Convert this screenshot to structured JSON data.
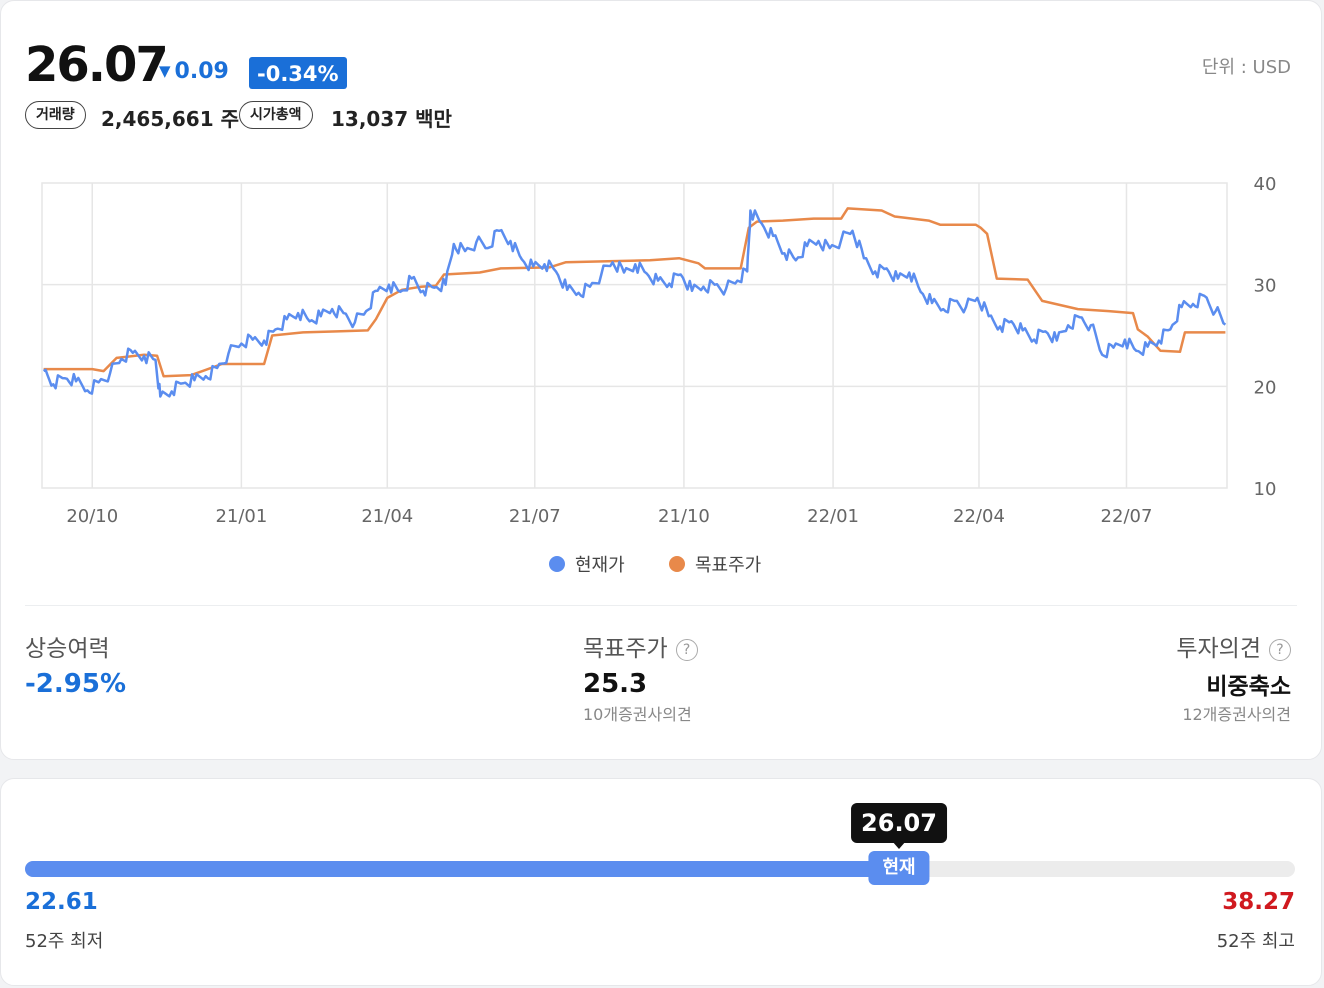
{
  "quote": {
    "price": "26.07",
    "change": "0.09",
    "change_arrow": "▼",
    "change_pct": "-0.34%",
    "unit": "단위 : USD",
    "volume_label": "거래량",
    "volume_value": "2,465,661 주",
    "market_cap_label": "시가총액",
    "market_cap_value": "13,037 백만"
  },
  "colors": {
    "current": "#5b8def",
    "target": "#e8894a",
    "down": "#1a6fd8",
    "high": "#d0191f"
  },
  "chart_data": {
    "type": "line",
    "x_ticks": [
      "20/10",
      "21/01",
      "21/04",
      "21/07",
      "21/10",
      "22/01",
      "22/04",
      "22/07"
    ],
    "x_tick_dates": [
      "2020-10-01",
      "2021-01-01",
      "2021-04-01",
      "2021-07-01",
      "2021-10-01",
      "2022-01-01",
      "2022-04-01",
      "2022-07-01"
    ],
    "x_range": [
      "2020-08-31",
      "2022-09-01"
    ],
    "y_ticks": [
      10,
      20,
      30,
      40
    ],
    "ylim": [
      10,
      40
    ],
    "grid": true,
    "y_axis_side": "right",
    "legend_position": "bottom-center",
    "series": [
      {
        "name": "현재가",
        "color": "#5b8def",
        "points": [
          [
            "2020-09-01",
            21.5
          ],
          [
            "2020-09-07",
            20.2
          ],
          [
            "2020-09-14",
            20.8
          ],
          [
            "2020-09-21",
            20.5
          ],
          [
            "2020-09-28",
            19.6
          ],
          [
            "2020-10-05",
            20.4
          ],
          [
            "2020-10-12",
            21.3
          ],
          [
            "2020-10-19",
            22.7
          ],
          [
            "2020-10-26",
            23.3
          ],
          [
            "2020-11-02",
            23.0
          ],
          [
            "2020-11-09",
            22.6
          ],
          [
            "2020-11-12",
            19.0
          ],
          [
            "2020-11-19",
            19.5
          ],
          [
            "2020-11-26",
            20.3
          ],
          [
            "2020-12-03",
            20.6
          ],
          [
            "2020-12-10",
            21.0
          ],
          [
            "2020-12-17",
            21.8
          ],
          [
            "2020-12-24",
            23.2
          ],
          [
            "2021-01-01",
            24.2
          ],
          [
            "2021-01-08",
            24.6
          ],
          [
            "2021-01-15",
            24.5
          ],
          [
            "2021-01-22",
            25.6
          ],
          [
            "2021-01-29",
            26.6
          ],
          [
            "2021-02-05",
            27.2
          ],
          [
            "2021-02-12",
            26.4
          ],
          [
            "2021-02-19",
            26.9
          ],
          [
            "2021-02-26",
            27.6
          ],
          [
            "2021-03-05",
            27.2
          ],
          [
            "2021-03-12",
            26.3
          ],
          [
            "2021-03-19",
            27.4
          ],
          [
            "2021-03-26",
            29.4
          ],
          [
            "2021-04-02",
            30.0
          ],
          [
            "2021-04-09",
            29.3
          ],
          [
            "2021-04-16",
            30.6
          ],
          [
            "2021-04-23",
            29.4
          ],
          [
            "2021-04-30",
            29.7
          ],
          [
            "2021-05-07",
            30.0
          ],
          [
            "2021-05-12",
            34.0
          ],
          [
            "2021-05-19",
            33.3
          ],
          [
            "2021-05-26",
            34.2
          ],
          [
            "2021-06-02",
            33.6
          ],
          [
            "2021-06-09",
            35.3
          ],
          [
            "2021-06-16",
            34.3
          ],
          [
            "2021-06-23",
            32.5
          ],
          [
            "2021-06-30",
            31.8
          ],
          [
            "2021-07-07",
            32.0
          ],
          [
            "2021-07-14",
            31.3
          ],
          [
            "2021-07-21",
            29.5
          ],
          [
            "2021-07-28",
            29.2
          ],
          [
            "2021-08-04",
            29.8
          ],
          [
            "2021-08-11",
            31.0
          ],
          [
            "2021-08-18",
            32.2
          ],
          [
            "2021-08-25",
            31.2
          ],
          [
            "2021-09-01",
            32.0
          ],
          [
            "2021-09-08",
            31.1
          ],
          [
            "2021-09-15",
            30.4
          ],
          [
            "2021-09-22",
            30.1
          ],
          [
            "2021-09-29",
            31.0
          ],
          [
            "2021-10-06",
            29.4
          ],
          [
            "2021-10-13",
            29.8
          ],
          [
            "2021-10-20",
            30.0
          ],
          [
            "2021-10-27",
            29.6
          ],
          [
            "2021-11-03",
            30.4
          ],
          [
            "2021-11-09",
            31.3
          ],
          [
            "2021-11-11",
            37.3
          ],
          [
            "2021-11-18",
            36.0
          ],
          [
            "2021-11-25",
            34.8
          ],
          [
            "2021-12-02",
            33.1
          ],
          [
            "2021-12-09",
            32.4
          ],
          [
            "2021-12-16",
            33.8
          ],
          [
            "2021-12-23",
            34.3
          ],
          [
            "2021-12-30",
            33.6
          ],
          [
            "2022-01-06",
            34.4
          ],
          [
            "2022-01-13",
            35.3
          ],
          [
            "2022-01-20",
            32.6
          ],
          [
            "2022-01-27",
            31.3
          ],
          [
            "2022-02-03",
            31.6
          ],
          [
            "2022-02-10",
            30.6
          ],
          [
            "2022-02-17",
            31.2
          ],
          [
            "2022-02-24",
            29.3
          ],
          [
            "2022-03-03",
            28.2
          ],
          [
            "2022-03-10",
            27.6
          ],
          [
            "2022-03-17",
            28.4
          ],
          [
            "2022-03-24",
            27.8
          ],
          [
            "2022-03-31",
            28.7
          ],
          [
            "2022-04-07",
            26.9
          ],
          [
            "2022-04-14",
            25.9
          ],
          [
            "2022-04-21",
            26.4
          ],
          [
            "2022-04-28",
            25.5
          ],
          [
            "2022-05-05",
            24.6
          ],
          [
            "2022-05-12",
            25.4
          ],
          [
            "2022-05-19",
            24.5
          ],
          [
            "2022-05-26",
            26.0
          ],
          [
            "2022-06-02",
            26.8
          ],
          [
            "2022-06-09",
            26.0
          ],
          [
            "2022-06-16",
            23.1
          ],
          [
            "2022-06-23",
            23.8
          ],
          [
            "2022-06-30",
            24.6
          ],
          [
            "2022-07-07",
            23.5
          ],
          [
            "2022-07-14",
            23.9
          ],
          [
            "2022-07-21",
            24.5
          ],
          [
            "2022-07-28",
            25.6
          ],
          [
            "2022-08-04",
            27.8
          ],
          [
            "2022-08-11",
            28.1
          ],
          [
            "2022-08-18",
            28.9
          ],
          [
            "2022-08-25",
            27.4
          ],
          [
            "2022-08-31",
            26.07
          ]
        ]
      },
      {
        "name": "목표주가",
        "color": "#e8894a",
        "points": [
          [
            "2020-09-01",
            21.7
          ],
          [
            "2020-10-01",
            21.7
          ],
          [
            "2020-10-08",
            21.5
          ],
          [
            "2020-10-16",
            22.8
          ],
          [
            "2020-11-02",
            23.1
          ],
          [
            "2020-11-10",
            23.0
          ],
          [
            "2020-11-14",
            21.0
          ],
          [
            "2020-12-01",
            21.1
          ],
          [
            "2020-12-08",
            21.5
          ],
          [
            "2020-12-20",
            22.2
          ],
          [
            "2021-01-15",
            22.2
          ],
          [
            "2021-01-20",
            25.0
          ],
          [
            "2021-02-08",
            25.3
          ],
          [
            "2021-03-01",
            25.4
          ],
          [
            "2021-03-20",
            25.5
          ],
          [
            "2021-03-25",
            26.6
          ],
          [
            "2021-04-01",
            28.7
          ],
          [
            "2021-04-10",
            29.5
          ],
          [
            "2021-04-22",
            29.8
          ],
          [
            "2021-05-01",
            29.9
          ],
          [
            "2021-05-06",
            31.0
          ],
          [
            "2021-05-28",
            31.2
          ],
          [
            "2021-06-10",
            31.6
          ],
          [
            "2021-07-10",
            31.7
          ],
          [
            "2021-07-20",
            32.2
          ],
          [
            "2021-08-15",
            32.3
          ],
          [
            "2021-09-10",
            32.4
          ],
          [
            "2021-09-28",
            32.6
          ],
          [
            "2021-10-10",
            32.1
          ],
          [
            "2021-10-14",
            31.6
          ],
          [
            "2021-11-05",
            31.6
          ],
          [
            "2021-11-10",
            35.6
          ],
          [
            "2021-11-15",
            36.2
          ],
          [
            "2021-12-01",
            36.3
          ],
          [
            "2021-12-20",
            36.5
          ],
          [
            "2022-01-06",
            36.5
          ],
          [
            "2022-01-10",
            37.5
          ],
          [
            "2022-01-31",
            37.3
          ],
          [
            "2022-02-08",
            36.7
          ],
          [
            "2022-03-01",
            36.3
          ],
          [
            "2022-03-08",
            35.9
          ],
          [
            "2022-03-30",
            35.9
          ],
          [
            "2022-04-02",
            35.6
          ],
          [
            "2022-04-06",
            35.0
          ],
          [
            "2022-04-12",
            30.6
          ],
          [
            "2022-05-01",
            30.5
          ],
          [
            "2022-05-10",
            28.4
          ],
          [
            "2022-06-01",
            27.6
          ],
          [
            "2022-06-20",
            27.4
          ],
          [
            "2022-07-05",
            27.2
          ],
          [
            "2022-07-08",
            25.6
          ],
          [
            "2022-07-14",
            24.9
          ],
          [
            "2022-07-22",
            23.5
          ],
          [
            "2022-08-03",
            23.4
          ],
          [
            "2022-08-06",
            25.3
          ],
          [
            "2022-08-31",
            25.3
          ]
        ]
      }
    ]
  },
  "legend": {
    "current": "현재가",
    "target": "목표주가"
  },
  "stats": {
    "upside_label": "상승여력",
    "upside_value": "-2.95%",
    "target_label": "목표주가",
    "target_value": "25.3",
    "target_sub": "10개증권사의견",
    "opinion_label": "투자의견",
    "opinion_value": "비중축소",
    "opinion_sub": "12개증권사의견",
    "help": "?"
  },
  "range52": {
    "current": "26.07",
    "current_num": 26.07,
    "current_label": "현재",
    "low": "22.61",
    "low_num": 22.61,
    "low_label": "52주 최저",
    "high": "38.27",
    "high_num": 38.27,
    "high_label": "52주 최고",
    "fill_fraction": 0.7
  }
}
